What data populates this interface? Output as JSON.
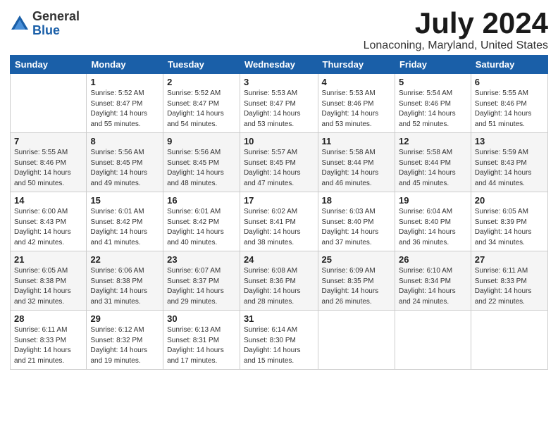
{
  "logo": {
    "general": "General",
    "blue": "Blue"
  },
  "title": "July 2024",
  "subtitle": "Lonaconing, Maryland, United States",
  "days_of_week": [
    "Sunday",
    "Monday",
    "Tuesday",
    "Wednesday",
    "Thursday",
    "Friday",
    "Saturday"
  ],
  "weeks": [
    [
      {
        "day": "",
        "info": ""
      },
      {
        "day": "1",
        "info": "Sunrise: 5:52 AM\nSunset: 8:47 PM\nDaylight: 14 hours\nand 55 minutes."
      },
      {
        "day": "2",
        "info": "Sunrise: 5:52 AM\nSunset: 8:47 PM\nDaylight: 14 hours\nand 54 minutes."
      },
      {
        "day": "3",
        "info": "Sunrise: 5:53 AM\nSunset: 8:47 PM\nDaylight: 14 hours\nand 53 minutes."
      },
      {
        "day": "4",
        "info": "Sunrise: 5:53 AM\nSunset: 8:46 PM\nDaylight: 14 hours\nand 53 minutes."
      },
      {
        "day": "5",
        "info": "Sunrise: 5:54 AM\nSunset: 8:46 PM\nDaylight: 14 hours\nand 52 minutes."
      },
      {
        "day": "6",
        "info": "Sunrise: 5:55 AM\nSunset: 8:46 PM\nDaylight: 14 hours\nand 51 minutes."
      }
    ],
    [
      {
        "day": "7",
        "info": "Sunrise: 5:55 AM\nSunset: 8:46 PM\nDaylight: 14 hours\nand 50 minutes."
      },
      {
        "day": "8",
        "info": "Sunrise: 5:56 AM\nSunset: 8:45 PM\nDaylight: 14 hours\nand 49 minutes."
      },
      {
        "day": "9",
        "info": "Sunrise: 5:56 AM\nSunset: 8:45 PM\nDaylight: 14 hours\nand 48 minutes."
      },
      {
        "day": "10",
        "info": "Sunrise: 5:57 AM\nSunset: 8:45 PM\nDaylight: 14 hours\nand 47 minutes."
      },
      {
        "day": "11",
        "info": "Sunrise: 5:58 AM\nSunset: 8:44 PM\nDaylight: 14 hours\nand 46 minutes."
      },
      {
        "day": "12",
        "info": "Sunrise: 5:58 AM\nSunset: 8:44 PM\nDaylight: 14 hours\nand 45 minutes."
      },
      {
        "day": "13",
        "info": "Sunrise: 5:59 AM\nSunset: 8:43 PM\nDaylight: 14 hours\nand 44 minutes."
      }
    ],
    [
      {
        "day": "14",
        "info": "Sunrise: 6:00 AM\nSunset: 8:43 PM\nDaylight: 14 hours\nand 42 minutes."
      },
      {
        "day": "15",
        "info": "Sunrise: 6:01 AM\nSunset: 8:42 PM\nDaylight: 14 hours\nand 41 minutes."
      },
      {
        "day": "16",
        "info": "Sunrise: 6:01 AM\nSunset: 8:42 PM\nDaylight: 14 hours\nand 40 minutes."
      },
      {
        "day": "17",
        "info": "Sunrise: 6:02 AM\nSunset: 8:41 PM\nDaylight: 14 hours\nand 38 minutes."
      },
      {
        "day": "18",
        "info": "Sunrise: 6:03 AM\nSunset: 8:40 PM\nDaylight: 14 hours\nand 37 minutes."
      },
      {
        "day": "19",
        "info": "Sunrise: 6:04 AM\nSunset: 8:40 PM\nDaylight: 14 hours\nand 36 minutes."
      },
      {
        "day": "20",
        "info": "Sunrise: 6:05 AM\nSunset: 8:39 PM\nDaylight: 14 hours\nand 34 minutes."
      }
    ],
    [
      {
        "day": "21",
        "info": "Sunrise: 6:05 AM\nSunset: 8:38 PM\nDaylight: 14 hours\nand 32 minutes."
      },
      {
        "day": "22",
        "info": "Sunrise: 6:06 AM\nSunset: 8:38 PM\nDaylight: 14 hours\nand 31 minutes."
      },
      {
        "day": "23",
        "info": "Sunrise: 6:07 AM\nSunset: 8:37 PM\nDaylight: 14 hours\nand 29 minutes."
      },
      {
        "day": "24",
        "info": "Sunrise: 6:08 AM\nSunset: 8:36 PM\nDaylight: 14 hours\nand 28 minutes."
      },
      {
        "day": "25",
        "info": "Sunrise: 6:09 AM\nSunset: 8:35 PM\nDaylight: 14 hours\nand 26 minutes."
      },
      {
        "day": "26",
        "info": "Sunrise: 6:10 AM\nSunset: 8:34 PM\nDaylight: 14 hours\nand 24 minutes."
      },
      {
        "day": "27",
        "info": "Sunrise: 6:11 AM\nSunset: 8:33 PM\nDaylight: 14 hours\nand 22 minutes."
      }
    ],
    [
      {
        "day": "28",
        "info": "Sunrise: 6:11 AM\nSunset: 8:33 PM\nDaylight: 14 hours\nand 21 minutes."
      },
      {
        "day": "29",
        "info": "Sunrise: 6:12 AM\nSunset: 8:32 PM\nDaylight: 14 hours\nand 19 minutes."
      },
      {
        "day": "30",
        "info": "Sunrise: 6:13 AM\nSunset: 8:31 PM\nDaylight: 14 hours\nand 17 minutes."
      },
      {
        "day": "31",
        "info": "Sunrise: 6:14 AM\nSunset: 8:30 PM\nDaylight: 14 hours\nand 15 minutes."
      },
      {
        "day": "",
        "info": ""
      },
      {
        "day": "",
        "info": ""
      },
      {
        "day": "",
        "info": ""
      }
    ]
  ]
}
